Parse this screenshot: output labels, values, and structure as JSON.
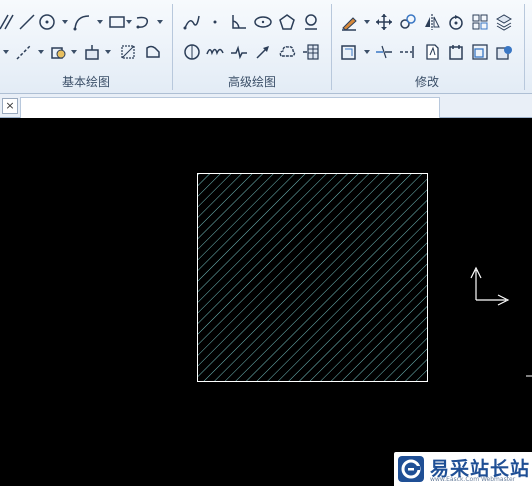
{
  "ribbon": {
    "groups": [
      {
        "label": "基本绘图"
      },
      {
        "label": "高级绘图"
      },
      {
        "label": "修改"
      }
    ]
  },
  "tab": {
    "close_symbol": "×"
  },
  "watermark": {
    "name": "易采站长站",
    "url": "www.Easck.Com Webmaster"
  }
}
